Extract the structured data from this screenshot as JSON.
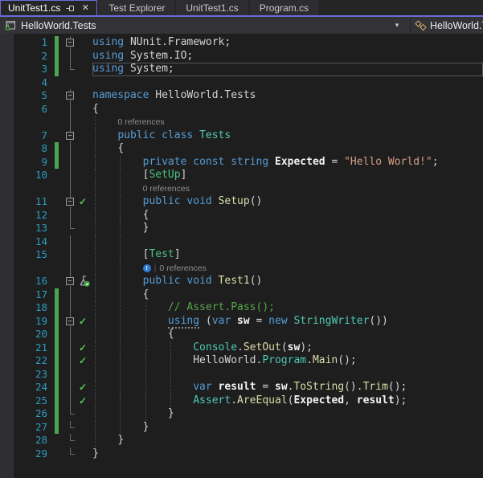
{
  "tabs": [
    {
      "label": "UnitTest1.cs",
      "active": true,
      "icons": [
        "pin-icon",
        "close-icon"
      ]
    },
    {
      "label": "Test Explorer",
      "active": false
    },
    {
      "label": "UnitTest1.cs",
      "active": false
    },
    {
      "label": "Program.cs",
      "active": false
    }
  ],
  "navbar": {
    "project": "HelloWorld.Tests",
    "project_icon": "test-project-icon",
    "dropdown_icon": "chevron-down-icon",
    "type_icon": "class-icon",
    "type_name": "HelloWorld.Te"
  },
  "icons": {
    "pin_icon": "sideways pushpin",
    "close_icon": "✕",
    "chevron_down_icon": "▾",
    "test_passed_icon": "✓",
    "test_beaker_icon": "beaker with green check badge",
    "codelens_info_icon": "!",
    "fold_collapse_glyph": "−"
  },
  "colors": {
    "accent_purple": "#6C6ADB",
    "editor_bg": "#1E1E1E",
    "tab_strip": "#252526",
    "tab_inactive": "#2D2D30",
    "navbar_bg": "#333337",
    "line_number": "#2E9CBE",
    "keyword": "#569CD6",
    "type": "#4EC9B0",
    "attribute": "#4BC47F",
    "method": "#DCDCAA",
    "string": "#D69D85",
    "comment": "#57A64A",
    "change_bar_green": "#4CA64F",
    "test_check_green": "#57C757",
    "codelens_text": "#8F8F8F"
  },
  "token_legend": {
    "k": "keyword",
    "ku": "keyword-underlined",
    "t": "type",
    "a": "attribute",
    "m": "method",
    "i": "identifier",
    "p": "plain",
    "w": "whitespace",
    "s": "string",
    "c": "comment"
  },
  "editor": {
    "current_line": 3,
    "rows": [
      {
        "t": "c",
        "n": 1,
        "ind": 0,
        "bar": true,
        "fold": "box",
        "tok": [
          [
            "k",
            "using"
          ],
          [
            "p",
            " NUnit.Framework;"
          ]
        ]
      },
      {
        "t": "c",
        "n": 2,
        "ind": 0,
        "bar": true,
        "fold": "line",
        "tok": [
          [
            "k",
            "using"
          ],
          [
            "p",
            " System.IO;"
          ]
        ]
      },
      {
        "t": "c",
        "n": 3,
        "ind": 0,
        "bar": true,
        "fold": "corner",
        "cur": true,
        "tok": [
          [
            "k",
            "using"
          ],
          [
            "p",
            " System;"
          ]
        ]
      },
      {
        "t": "c",
        "n": 4,
        "ind": 0,
        "tok": []
      },
      {
        "t": "c",
        "n": 5,
        "ind": 0,
        "fold": "box",
        "tok": [
          [
            "k",
            "namespace"
          ],
          [
            "p",
            " HelloWorld.Tests"
          ]
        ]
      },
      {
        "t": "c",
        "n": 6,
        "ind": 0,
        "fold": "line",
        "tok": [
          [
            "p",
            "{"
          ]
        ]
      },
      {
        "t": "l",
        "ind": 4,
        "fold": "line",
        "lens": "0 references"
      },
      {
        "t": "c",
        "n": 7,
        "ind": 4,
        "fold": "box",
        "tok": [
          [
            "w",
            "    "
          ],
          [
            "k",
            "public class "
          ],
          [
            "t",
            "Tests"
          ]
        ]
      },
      {
        "t": "c",
        "n": 8,
        "ind": 4,
        "bar": true,
        "fold": "line",
        "tok": [
          [
            "w",
            "    "
          ],
          [
            "p",
            "{"
          ]
        ]
      },
      {
        "t": "c",
        "n": 9,
        "ind": 8,
        "bar": true,
        "fold": "line",
        "tok": [
          [
            "w",
            "        "
          ],
          [
            "k",
            "private const string "
          ],
          [
            "i",
            "Expected"
          ],
          [
            "p",
            " = "
          ],
          [
            "s",
            "\"Hello World!\""
          ],
          [
            "p",
            ";"
          ]
        ]
      },
      {
        "t": "c",
        "n": 10,
        "ind": 8,
        "fold": "line",
        "tok": [
          [
            "w",
            "        "
          ],
          [
            "p",
            "["
          ],
          [
            "a",
            "SetUp"
          ],
          [
            "p",
            "]"
          ]
        ]
      },
      {
        "t": "l",
        "ind": 8,
        "fold": "line",
        "lens": "0 references"
      },
      {
        "t": "c",
        "n": 11,
        "ind": 8,
        "fold": "box",
        "chk": true,
        "tok": [
          [
            "w",
            "        "
          ],
          [
            "k",
            "public void "
          ],
          [
            "m",
            "Setup"
          ],
          [
            "p",
            "()"
          ]
        ]
      },
      {
        "t": "c",
        "n": 12,
        "ind": 8,
        "fold": "line",
        "tok": [
          [
            "w",
            "        "
          ],
          [
            "p",
            "{"
          ]
        ]
      },
      {
        "t": "c",
        "n": 13,
        "ind": 8,
        "fold": "corner",
        "tok": [
          [
            "w",
            "        "
          ],
          [
            "p",
            "}"
          ]
        ]
      },
      {
        "t": "c",
        "n": 14,
        "ind": 8,
        "fold": "line",
        "tok": []
      },
      {
        "t": "c",
        "n": 15,
        "ind": 8,
        "fold": "line",
        "tok": [
          [
            "w",
            "        "
          ],
          [
            "p",
            "["
          ],
          [
            "a",
            "Test"
          ],
          [
            "p",
            "]"
          ]
        ]
      },
      {
        "t": "l",
        "ind": 8,
        "fold": "line",
        "lens": "0 references",
        "icon": true
      },
      {
        "t": "c",
        "n": 16,
        "ind": 8,
        "fold": "box",
        "bk": true,
        "tok": [
          [
            "w",
            "        "
          ],
          [
            "k",
            "public void "
          ],
          [
            "m",
            "Test1"
          ],
          [
            "p",
            "()"
          ]
        ]
      },
      {
        "t": "c",
        "n": 17,
        "ind": 8,
        "bar": true,
        "fold": "line",
        "tok": [
          [
            "w",
            "        "
          ],
          [
            "p",
            "{"
          ]
        ]
      },
      {
        "t": "c",
        "n": 18,
        "ind": 12,
        "bar": true,
        "fold": "line",
        "tok": [
          [
            "w",
            "            "
          ],
          [
            "c",
            "// Assert.Pass();"
          ]
        ]
      },
      {
        "t": "c",
        "n": 19,
        "ind": 12,
        "bar": true,
        "fold": "box",
        "chk": true,
        "tok": [
          [
            "w",
            "            "
          ],
          [
            "ku",
            "using"
          ],
          [
            "p",
            " ("
          ],
          [
            "k",
            "var "
          ],
          [
            "i",
            "sw"
          ],
          [
            "p",
            " = "
          ],
          [
            "k",
            "new "
          ],
          [
            "t",
            "StringWriter"
          ],
          [
            "p",
            "())"
          ]
        ]
      },
      {
        "t": "c",
        "n": 20,
        "ind": 12,
        "bar": true,
        "fold": "line",
        "tok": [
          [
            "w",
            "            "
          ],
          [
            "p",
            "{"
          ]
        ]
      },
      {
        "t": "c",
        "n": 21,
        "ind": 16,
        "bar": true,
        "fold": "line",
        "chk": true,
        "tok": [
          [
            "w",
            "                "
          ],
          [
            "t",
            "Console"
          ],
          [
            "p",
            "."
          ],
          [
            "m",
            "SetOut"
          ],
          [
            "p",
            "("
          ],
          [
            "i",
            "sw"
          ],
          [
            "p",
            ");"
          ]
        ]
      },
      {
        "t": "c",
        "n": 22,
        "ind": 16,
        "bar": true,
        "fold": "line",
        "chk": true,
        "tok": [
          [
            "w",
            "                "
          ],
          [
            "p",
            "HelloWorld."
          ],
          [
            "t",
            "Program"
          ],
          [
            "p",
            "."
          ],
          [
            "m",
            "Main"
          ],
          [
            "p",
            "();"
          ]
        ]
      },
      {
        "t": "c",
        "n": 23,
        "ind": 16,
        "bar": true,
        "fold": "line",
        "tok": []
      },
      {
        "t": "c",
        "n": 24,
        "ind": 16,
        "bar": true,
        "fold": "line",
        "chk": true,
        "tok": [
          [
            "w",
            "                "
          ],
          [
            "k",
            "var "
          ],
          [
            "i",
            "result"
          ],
          [
            "p",
            " = "
          ],
          [
            "i",
            "sw"
          ],
          [
            "p",
            "."
          ],
          [
            "m",
            "ToString"
          ],
          [
            "p",
            "()."
          ],
          [
            "m",
            "Trim"
          ],
          [
            "p",
            "();"
          ]
        ]
      },
      {
        "t": "c",
        "n": 25,
        "ind": 16,
        "bar": true,
        "fold": "line",
        "chk": true,
        "tok": [
          [
            "w",
            "                "
          ],
          [
            "t",
            "Assert"
          ],
          [
            "p",
            "."
          ],
          [
            "m",
            "AreEqual"
          ],
          [
            "p",
            "("
          ],
          [
            "i",
            "Expected"
          ],
          [
            "p",
            ", "
          ],
          [
            "i",
            "result"
          ],
          [
            "p",
            ");"
          ]
        ]
      },
      {
        "t": "c",
        "n": 26,
        "ind": 12,
        "bar": true,
        "fold": "corner",
        "tok": [
          [
            "w",
            "            "
          ],
          [
            "p",
            "}"
          ]
        ]
      },
      {
        "t": "c",
        "n": 27,
        "ind": 8,
        "bar": true,
        "fold": "corner",
        "tok": [
          [
            "w",
            "        "
          ],
          [
            "p",
            "}"
          ]
        ]
      },
      {
        "t": "c",
        "n": 28,
        "ind": 4,
        "fold": "corner",
        "tok": [
          [
            "w",
            "    "
          ],
          [
            "p",
            "}"
          ]
        ]
      },
      {
        "t": "c",
        "n": 29,
        "ind": 0,
        "fold": "corner",
        "tok": [
          [
            "p",
            "}"
          ]
        ]
      }
    ]
  }
}
